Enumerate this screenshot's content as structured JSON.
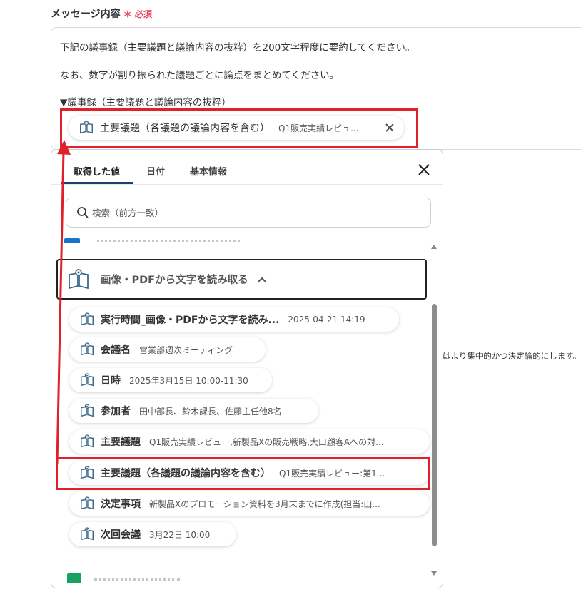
{
  "field": {
    "label": "メッセージ内容",
    "required_mark": "＊",
    "required_text": "必須"
  },
  "message": {
    "line1": "下記の議事録（主要議題と議論内容の抜粋）を200文字程度に要約してください。",
    "line2": "なお、数字が割り振られた議題ごとに論点をまとめてください。",
    "line3": "▼議事録（主要議題と議論内容の抜粋）",
    "chip": {
      "label": "主要議題（各議題の議論内容を含む）",
      "value": "Q1販売実績レビュ..."
    }
  },
  "side_text": "はより集中的かつ決定論的にします。",
  "popup": {
    "tabs": [
      "取得した値",
      "日付",
      "基本情報"
    ],
    "search_placeholder": "検索（前方一致）",
    "section_title": "画像・PDFから文字を読み取る",
    "items": [
      {
        "label": "実行時間_画像・PDFから文字を読み...",
        "value": "2025-04-21 14:19"
      },
      {
        "label": "会議名",
        "value": "営業部週次ミーティング"
      },
      {
        "label": "日時",
        "value": "2025年3月15日 10:00-11:30"
      },
      {
        "label": "参加者",
        "value": "田中部長、鈴木課長、佐藤主任他8名"
      },
      {
        "label": "主要議題",
        "value": "Q1販売実績レビュー,新製品Xの販売戦略,大口顧客Aへの対..."
      },
      {
        "label": "主要議題（各議題の議論内容を含む）",
        "value": "Q1販売実績レビュー:第1..."
      },
      {
        "label": "決定事項",
        "value": "新製品Xのプロモーション資料を3月末までに作成(担当:山..."
      },
      {
        "label": "次回会議",
        "value": "3月22日 10:00"
      }
    ]
  },
  "colors": {
    "highlight": "#e0202a",
    "tab_underline": "#1d3f6e",
    "required": "#e5455a"
  },
  "icons": [
    "book-icon",
    "close-icon",
    "search-icon",
    "chevron-up-icon"
  ]
}
